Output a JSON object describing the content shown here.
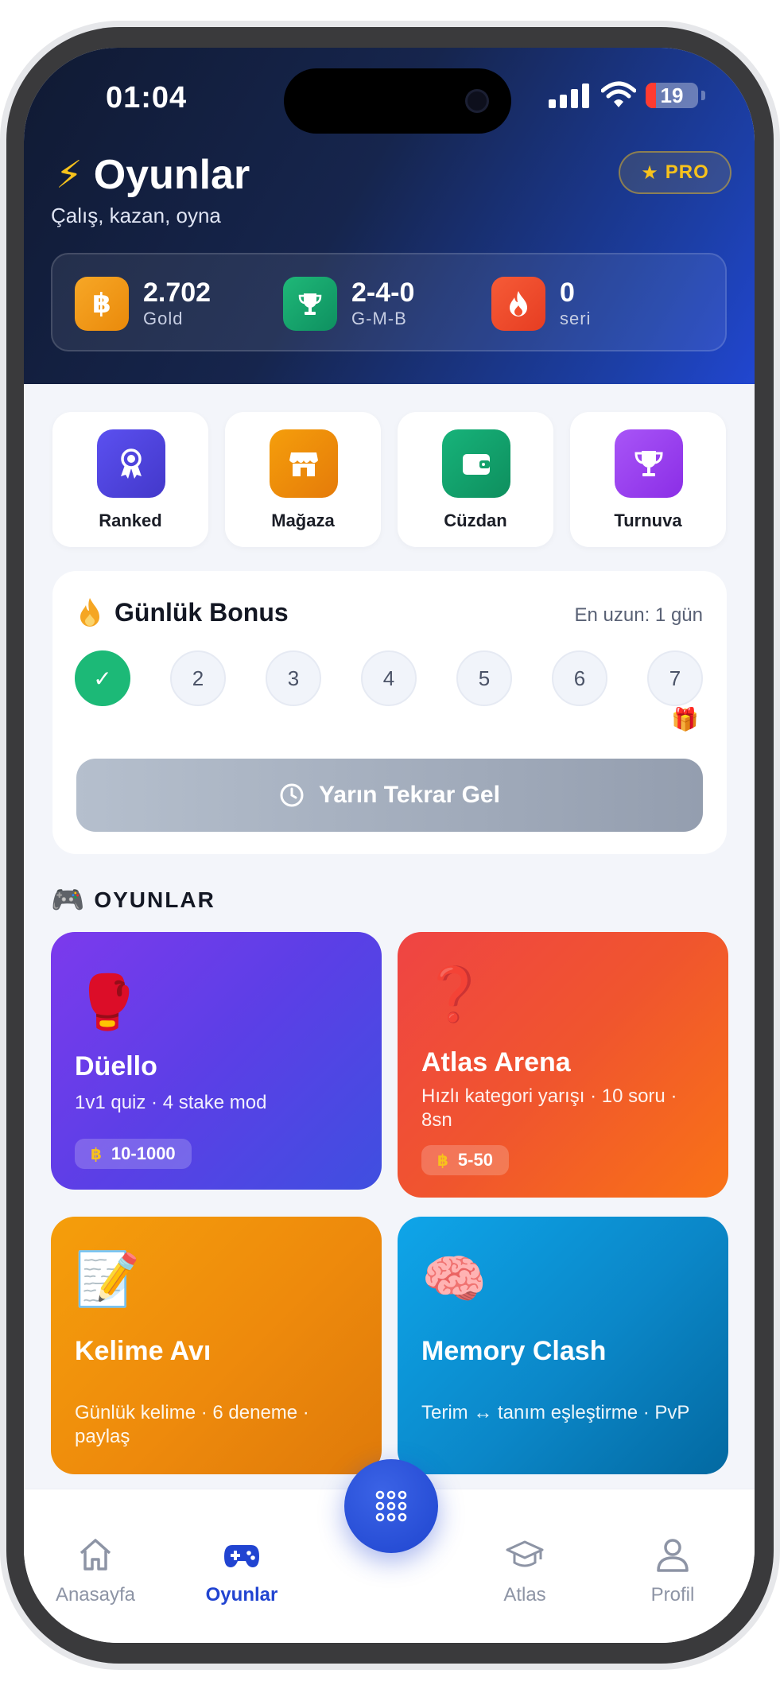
{
  "status_bar": {
    "time": "01:04",
    "battery": "19"
  },
  "header": {
    "icon": "lightning-icon",
    "title": "Oyunlar",
    "subtitle": "Çalış, kazan, oyna",
    "pro_badge": "PRO"
  },
  "stats": [
    {
      "icon": "coin-icon",
      "value": "2.702",
      "label": "Gold",
      "color": "#f39a16"
    },
    {
      "icon": "trophy-icon",
      "value": "2-4-0",
      "label": "G-M-B",
      "color": "#16a56a"
    },
    {
      "icon": "flame-icon",
      "value": "0",
      "label": "seri",
      "color": "#f04a2c"
    }
  ],
  "quick_actions": [
    {
      "label": "Ranked",
      "icon": "ribbon-icon",
      "color": "#4f46e5"
    },
    {
      "label": "Mağaza",
      "icon": "store-icon",
      "color": "#f08c0c"
    },
    {
      "label": "Cüzdan",
      "icon": "wallet-icon",
      "color": "#13a06b"
    },
    {
      "label": "Turnuva",
      "icon": "trophy-icon",
      "color": "#9d3ff0"
    }
  ],
  "daily_bonus": {
    "title": "Günlük Bonus",
    "record": "En uzun: 1 gün",
    "days": [
      "✓",
      "2",
      "3",
      "4",
      "5",
      "6",
      "7"
    ],
    "button_label": "Yarın Tekrar Gel"
  },
  "games_section": {
    "title": "OYUNLAR"
  },
  "games": [
    {
      "emoji": "🥊",
      "title": "Düello",
      "desc": "1v1 quiz · 4 stake mod",
      "stake": "10-1000"
    },
    {
      "emoji": "❓",
      "title": "Atlas Arena",
      "desc": "Hızlı kategori yarışı · 10 soru · 8sn",
      "stake": "5-50"
    },
    {
      "emoji": "📝",
      "title": "Kelime Avı",
      "desc": "Günlük kelime · 6 deneme · paylaş"
    },
    {
      "emoji": "🧠",
      "title": "Memory Clash",
      "desc": "Terim ↔ tanım eşleştirme · PvP"
    }
  ],
  "tabbar": {
    "items": [
      {
        "label": "Anasayfa",
        "icon": "home-icon"
      },
      {
        "label": "Oyunlar",
        "icon": "gamepad-icon"
      },
      {
        "label": "Atlas",
        "icon": "graduation-cap-icon"
      },
      {
        "label": "Profil",
        "icon": "user-icon"
      }
    ],
    "active": "Oyunlar"
  },
  "colors": {
    "accent": "#2144d1",
    "success": "#1cb977",
    "gold": "#f7c21c"
  }
}
